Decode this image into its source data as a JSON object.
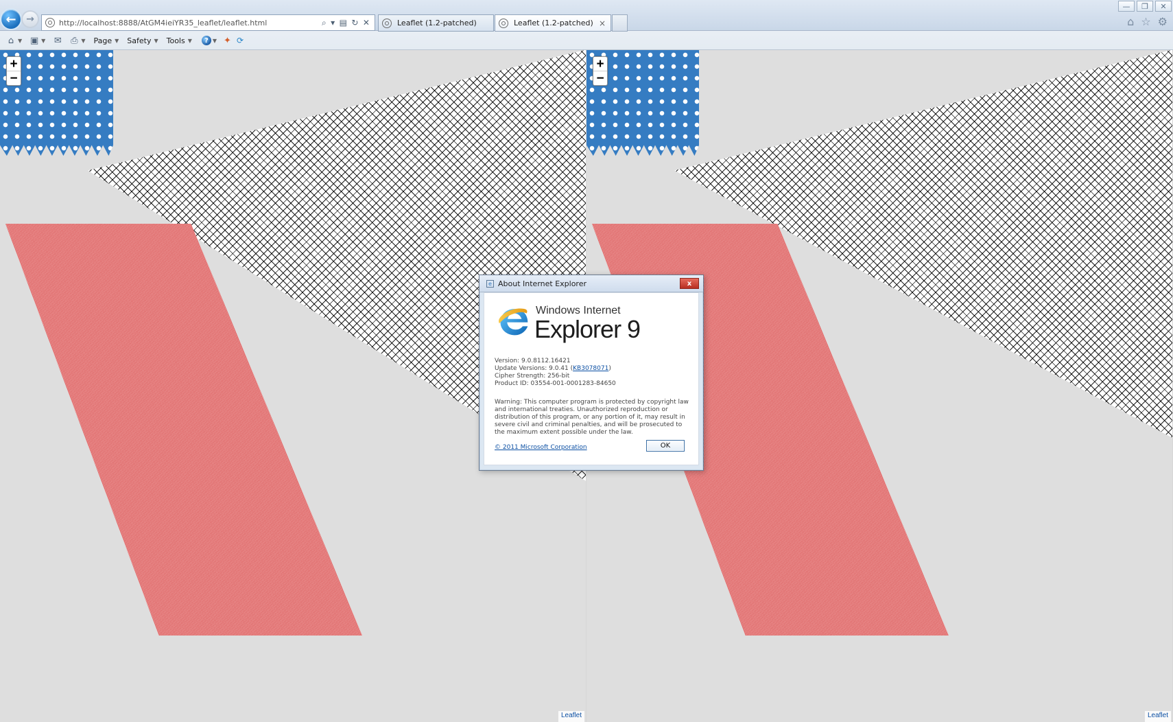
{
  "browser": {
    "address_url": "http://localhost:8888/AtGM4ieiYR35_leaflet/leaflet.html",
    "tabs": [
      {
        "label": "Leaflet (1.2-patched)"
      },
      {
        "label": "Leaflet (1.2-patched)"
      }
    ],
    "tab_close_glyph": "×",
    "command_bar": {
      "page_label": "Page",
      "safety_label": "Safety",
      "tools_label": "Tools"
    }
  },
  "map": {
    "zoom_in_label": "+",
    "zoom_out_label": "−",
    "attribution_left": "Leaflet",
    "attribution_right": "Leaflet"
  },
  "dialog": {
    "title": "About Internet Explorer",
    "close_label": "x",
    "brand_line1": "Windows Internet",
    "brand_line2": "Explorer 9",
    "version": "Version: 9.0.8112.16421",
    "update_versions_prefix": "Update Versions: 9.0.41 (",
    "update_versions_link": "KB3078071",
    "update_versions_suffix": ")",
    "cipher_strength": "Cipher Strength: 256-bit",
    "product_id": "Product ID: 03554-001-0001283-84650",
    "warning": "Warning: This computer program is protected by copyright law and international treaties. Unauthorized reproduction or distribution of this program, or any portion of it, may result in severe civil and criminal penalties, and will be prosecuted to the maximum extent possible under the law.",
    "copyright_link": "© 2011 Microsoft Corporation",
    "ok_label": "OK"
  },
  "icons": {
    "back": "back-arrow-icon",
    "forward": "forward-arrow-icon",
    "site": "site-globe-icon",
    "search": "search-icon",
    "dropdown": "chevron-down-icon",
    "compatibility": "compatibility-view-icon",
    "refresh": "refresh-icon",
    "stop": "stop-icon",
    "home": "home-icon",
    "favorites": "favorites-star-icon",
    "tools": "gear-icon",
    "ie": "internet-explorer-icon"
  }
}
